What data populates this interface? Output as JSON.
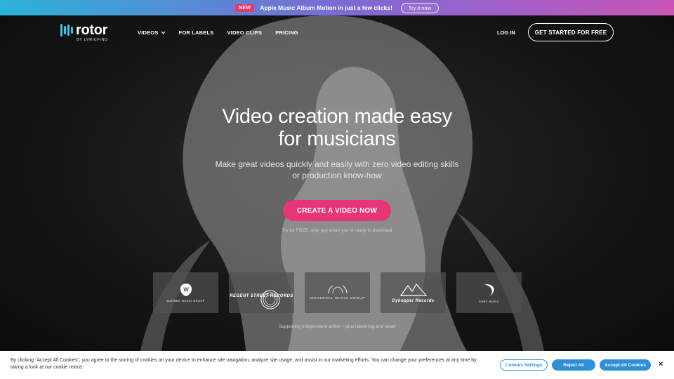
{
  "announcement": {
    "badge": "NEW",
    "message": "Apple Music Album Motion in just a few clicks!",
    "button": "Try it now"
  },
  "nav": {
    "logo_word": "rotor",
    "logo_sub": "BY LYRICFIND",
    "links": [
      "VIDEOS",
      "FOR LABELS",
      "VIDEO CLIPS",
      "PRICING"
    ],
    "login": "LOG IN",
    "get_started": "GET STARTED FOR FREE"
  },
  "hero": {
    "headline_line1": "Video creation made easy",
    "headline_line2": "for musicians",
    "subhead": "Make great videos quickly and easily with zero video editing skills or production know-how",
    "cta": "CREATE A VIDEO NOW",
    "cta_note": "Try for FREE, only pay when you're ready to download",
    "support": "Supporting independent artists – plus labels big and small"
  },
  "labels": [
    {
      "name": "Warner Music Group",
      "caption": "WARNER MUSIC GROUP"
    },
    {
      "name": "Regent Street Records",
      "caption": "REGENT STREET RECORDS"
    },
    {
      "name": "Universal Music Group",
      "caption": "UNIVERSAL MUSIC GROUP"
    },
    {
      "name": "Dyhopper Records",
      "caption": "Dyhopper Records"
    },
    {
      "name": "Sony Music",
      "caption": "SONY MUSIC"
    }
  ],
  "cookie": {
    "text": "By clicking “Accept All Cookies”, you agree to the storing of cookies on your device to enhance site navigation, analyze site usage, and assist in our marketing efforts. You can change your preferences at any time by taking a look at our cookie notice.",
    "settings": "Cookies Settings",
    "reject": "Reject All",
    "accept": "Accept All Cookies",
    "close": "×"
  },
  "colors": {
    "accent_pink": "#e8357a",
    "logo_blue": "#3fc3e8",
    "cookie_blue": "#2f8ed8"
  }
}
